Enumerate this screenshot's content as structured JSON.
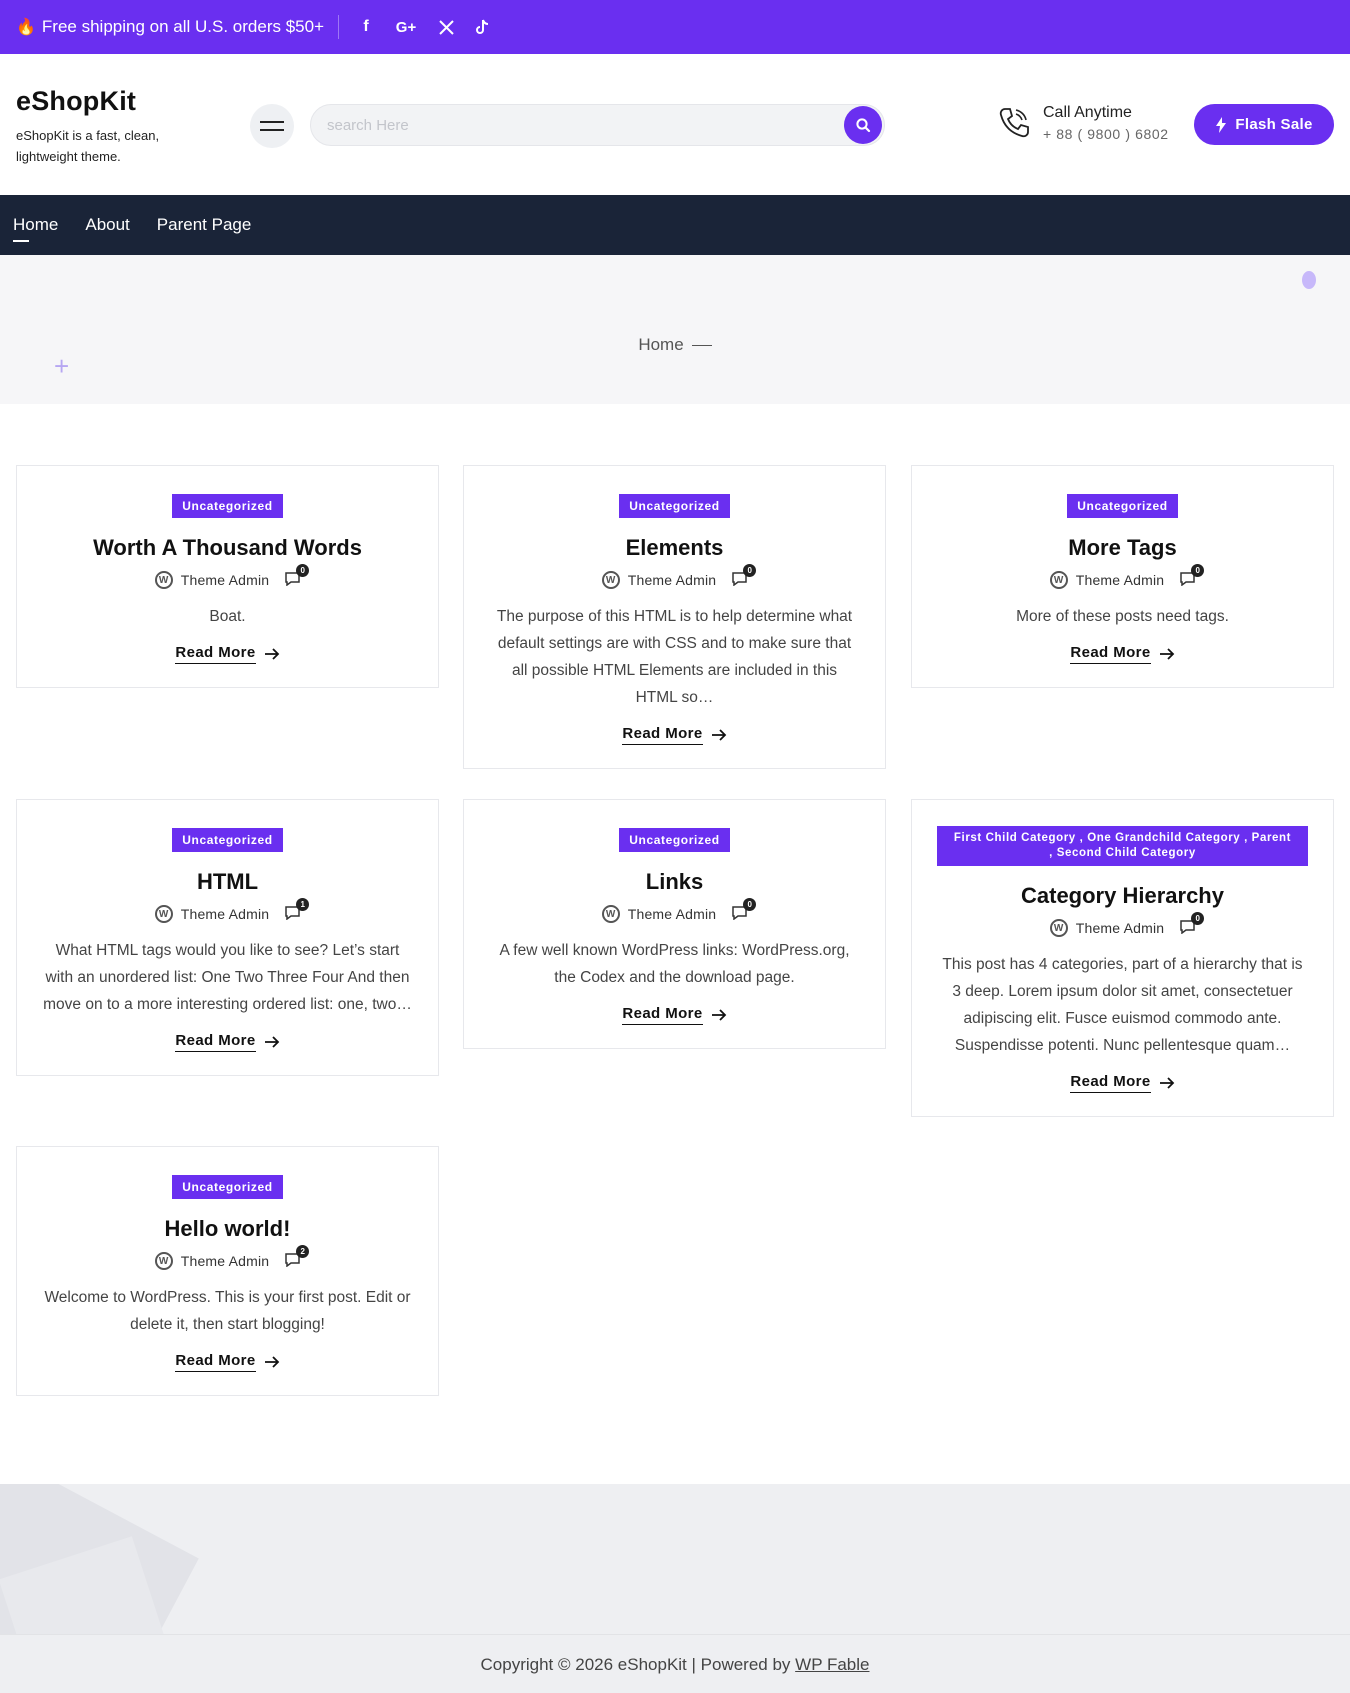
{
  "topbar": {
    "shipping_text": "Free shipping on all U.S. orders $50+",
    "social": [
      "facebook-icon",
      "google-plus-icon",
      "x-icon",
      "tiktok-icon"
    ],
    "google_label": "G+"
  },
  "header": {
    "site_title": "eShopKit",
    "tagline": "eShopKit is a fast, clean, lightweight theme.",
    "search_placeholder": "search Here",
    "call_title": "Call Anytime",
    "call_number": "+ 88 ( 9800 ) 6802",
    "flash_label": "Flash Sale"
  },
  "nav": {
    "items": [
      "Home",
      "About",
      "Parent Page"
    ]
  },
  "breadcrumb": {
    "current": "Home"
  },
  "colors": {
    "accent": "#6a2ff0",
    "nav_bg": "#1a2438"
  },
  "posts": [
    {
      "category": "Uncategorized",
      "title": "Worth A Thousand Words",
      "author": "Theme Admin",
      "comments": "0",
      "excerpt": "Boat.",
      "read_more": "Read More"
    },
    {
      "category": "Uncategorized",
      "title": "Elements",
      "author": "Theme Admin",
      "comments": "0",
      "excerpt": "The purpose of this HTML is to help determine what default settings are with CSS and to make sure that all possible HTML Elements are included in this HTML so…",
      "read_more": "Read More"
    },
    {
      "category": "Uncategorized",
      "title": "More Tags",
      "author": "Theme Admin",
      "comments": "0",
      "excerpt": "More of these posts need tags.",
      "read_more": "Read More"
    },
    {
      "category": "Uncategorized",
      "title": "HTML",
      "author": "Theme Admin",
      "comments": "1",
      "excerpt": "What HTML tags would you like to see? Let’s start with an unordered list: One Two Three Four And then move on to a more interesting ordered list: one, two…",
      "read_more": "Read More"
    },
    {
      "category": "Uncategorized",
      "title": "Links",
      "author": "Theme Admin",
      "comments": "0",
      "excerpt": "A few well known WordPress links: WordPress.org, the Codex and the download page.",
      "read_more": "Read More"
    },
    {
      "category": "First Child Category , One Grandchild Category , Parent , Second Child Category",
      "title": "Category Hierarchy",
      "author": "Theme Admin",
      "comments": "0",
      "excerpt": "This post has 4 categories, part of a hierarchy that is 3 deep. Lorem ipsum dolor sit amet, consectetuer adipiscing elit. Fusce euismod commodo ante. Suspendisse potenti. Nunc pellentesque quam…",
      "read_more": "Read More"
    },
    {
      "category": "Uncategorized",
      "title": "Hello world!",
      "author": "Theme Admin",
      "comments": "2",
      "excerpt": "Welcome to WordPress. This is your first post. Edit or delete it, then start blogging!",
      "read_more": "Read More"
    }
  ],
  "footer": {
    "copyright": "Copyright © 2026 eShopKit | Powered by",
    "powered_link": "WP Fable"
  }
}
